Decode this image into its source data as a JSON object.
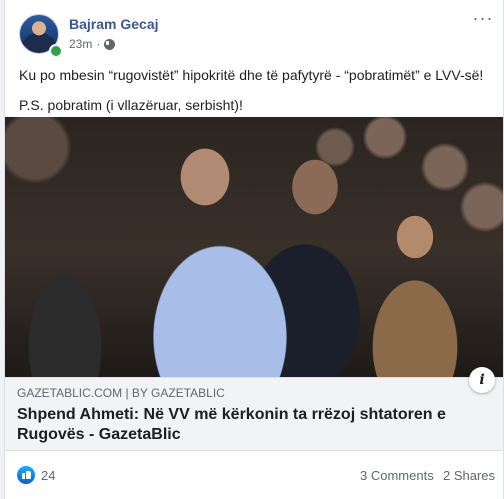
{
  "post": {
    "author": "Bajram Gecaj",
    "time": "23m",
    "separator": "·",
    "audience_icon": "globe-icon",
    "more_icon": "more-options-icon",
    "text_lines": [
      "Ku po mbesin “rugovistët” hipokritë dhe të pafytyrë - “pobratimët” e LVV-së!",
      "P.S. pobratim (i vllazëruar, serbisht)!"
    ]
  },
  "link_preview": {
    "domain": "GAZETABLIC.COM | BY GAZETABLIC",
    "title": "Shpend Ahmeti: Në VV më kërkonin ta rrëzoj shtatoren e Rugovës - GazetaBlic",
    "info_label": "i"
  },
  "footer": {
    "like_count": "24",
    "comments": "3 Comments",
    "shares": "2 Shares"
  },
  "colors": {
    "author": "#385898",
    "online": "#31a24c",
    "like_blue": "#1877f2"
  }
}
